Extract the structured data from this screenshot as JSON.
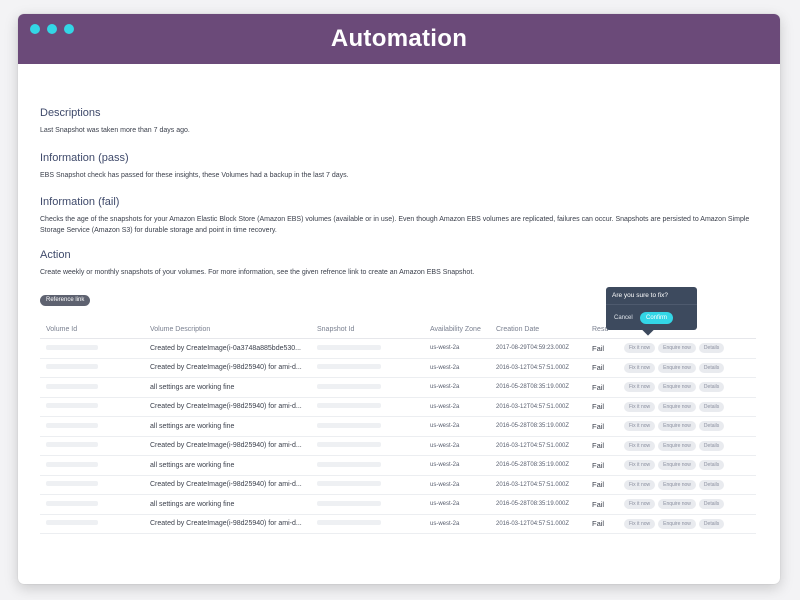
{
  "window": {
    "title": "Automation"
  },
  "sections": [
    {
      "title": "Descriptions",
      "text": "Last Snapshot was taken more than 7 days ago."
    },
    {
      "title": "Information (pass)",
      "text": "EBS Snapshot check has passed for these insights, these Volumes had a backup in the last 7 days."
    },
    {
      "title": "Information (fail)",
      "text": "Checks the age of the snapshots for your Amazon Elastic Block Store (Amazon EBS) volumes (available or in use). Even though Amazon EBS volumes are replicated, failures can occur. Snapshots are persisted to Amazon Simple Storage Service (Amazon S3) for durable storage and point in time recovery."
    },
    {
      "title": "Action",
      "text": "Create weekly or monthly snapshots of your volumes. For more information, see the given refrence link to create an Amazon EBS Snapshot."
    }
  ],
  "reference_button": "Reference link",
  "table": {
    "headers": [
      "Volume Id",
      "Volume Description",
      "Snapshot Id",
      "Availability Zone",
      "Creation Date",
      "Resu"
    ],
    "rows": [
      {
        "description": "Created by CreateImage(i-0a3748a885bde530...",
        "zone": "us-west-2a",
        "date": "2017-08-29T04:59:23.000Z",
        "result": "Fail"
      },
      {
        "description": "Created by CreateImage(i-98d25940) for ami-d...",
        "zone": "us-west-2a",
        "date": "2016-03-12T04:57:51.000Z",
        "result": "Fail"
      },
      {
        "description": "all settings are working fine",
        "zone": "us-west-2a",
        "date": "2016-05-28T08:35:19.000Z",
        "result": "Fail"
      },
      {
        "description": "Created by CreateImage(i-98d25940) for ami-d...",
        "zone": "us-west-2a",
        "date": "2016-03-12T04:57:51.000Z",
        "result": "Fail"
      },
      {
        "description": "all settings are working fine",
        "zone": "us-west-2a",
        "date": "2016-05-28T08:35:19.000Z",
        "result": "Fail"
      },
      {
        "description": "Created by CreateImage(i-98d25940) for ami-d...",
        "zone": "us-west-2a",
        "date": "2016-03-12T04:57:51.000Z",
        "result": "Fail"
      },
      {
        "description": "all settings are working fine",
        "zone": "us-west-2a",
        "date": "2016-05-28T08:35:19.000Z",
        "result": "Fail"
      },
      {
        "description": "Created by CreateImage(i-98d25940) for ami-d...",
        "zone": "us-west-2a",
        "date": "2016-03-12T04:57:51.000Z",
        "result": "Fail"
      },
      {
        "description": "all settings are working fine",
        "zone": "us-west-2a",
        "date": "2016-05-28T08:35:19.000Z",
        "result": "Fail"
      },
      {
        "description": "Created by CreateImage(i-98d25940) for ami-d...",
        "zone": "us-west-2a",
        "date": "2016-03-12T04:57:51.000Z",
        "result": "Fail"
      }
    ],
    "actions": {
      "fix": "Fix it now",
      "enquire": "Enquire now",
      "details": "Details"
    }
  },
  "popover": {
    "title": "Are you sure to fix?",
    "cancel": "Cancel",
    "confirm": "Confirm"
  },
  "colors": {
    "header": "#6b4a79",
    "accent": "#33d6e6",
    "popover": "#3d4a5e"
  }
}
